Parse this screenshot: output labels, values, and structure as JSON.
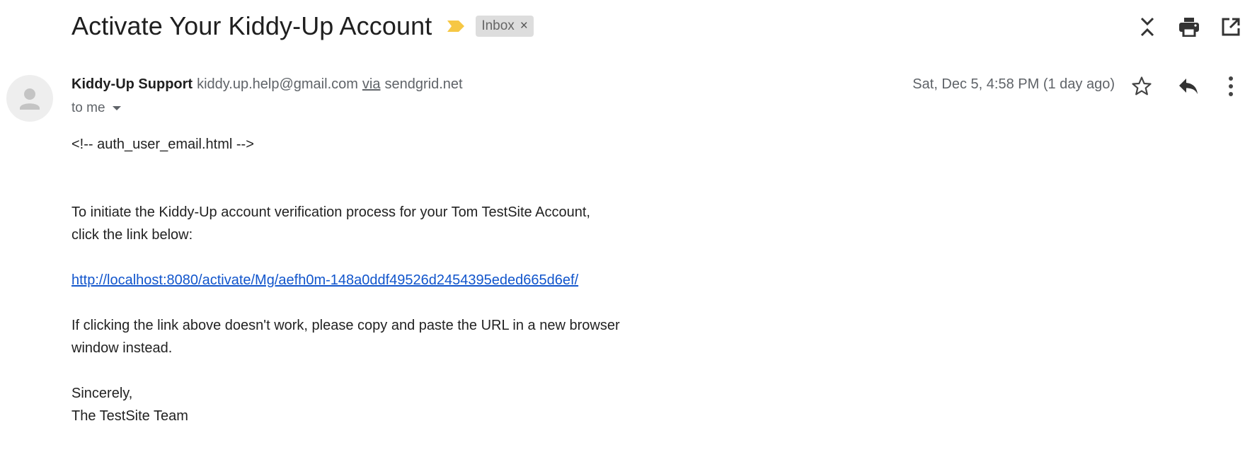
{
  "subject": "Activate Your Kiddy-Up Account",
  "label": {
    "name": "Inbox",
    "remove_glyph": "×"
  },
  "icons": {
    "importance": "importance-marker-icon",
    "collapse": "collapse-all-icon",
    "print": "print-icon",
    "open_new": "open-in-new-window-icon",
    "avatar": "person-icon",
    "star": "star-icon",
    "reply": "reply-icon",
    "more": "more-vert-icon"
  },
  "colors": {
    "importance": "#f6c744",
    "link": "#1155cc",
    "chip_bg": "#dddddd"
  },
  "sender": {
    "name": "Kiddy-Up Support",
    "email": "kiddy.up.help@gmail.com",
    "via_label": "via",
    "via_domain": "sendgrid.net"
  },
  "recipient": {
    "to_text": "to me"
  },
  "date": "Sat, Dec 5, 4:58 PM (1 day ago)",
  "body": {
    "comment": "<!-- auth_user_email.html -->",
    "line1": "To initiate the Kiddy-Up account verification process for your Tom TestSite Account,",
    "line2": "click the link below:",
    "link": "http://localhost:8080/activate/Mg/aefh0m-148a0ddf49526d2454395eded665d6ef/",
    "line3": "If clicking the link above doesn't work, please copy and paste the URL in a new browser",
    "line4": "window instead.",
    "signoff": "Sincerely,",
    "signature": "The TestSite Team"
  }
}
